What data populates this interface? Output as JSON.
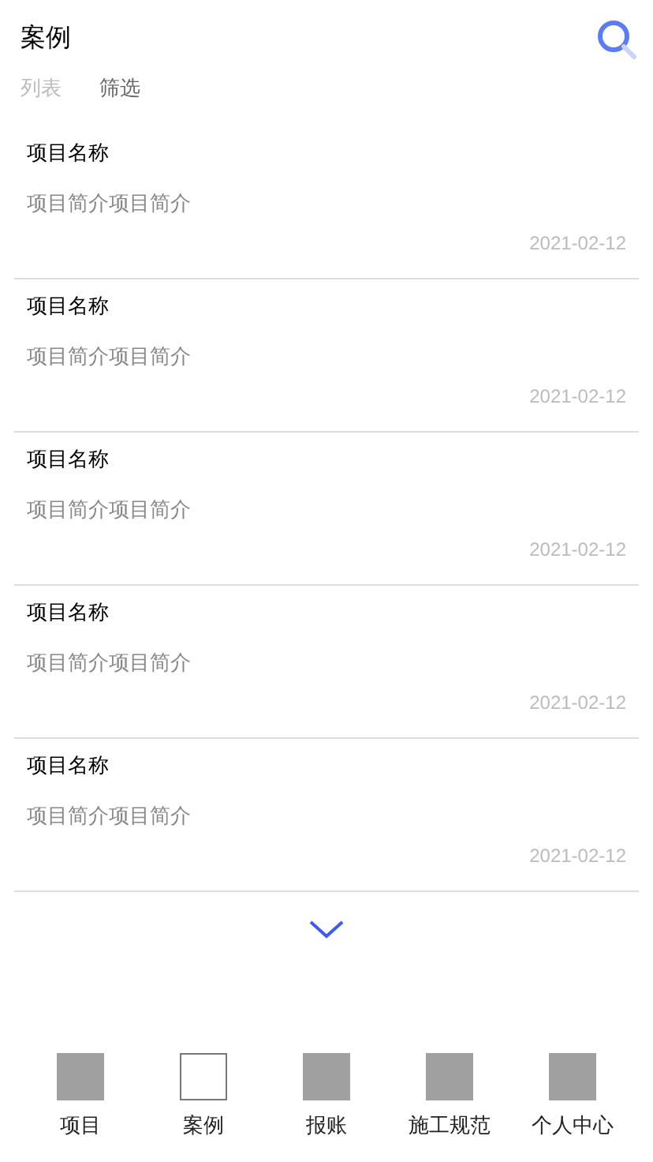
{
  "header": {
    "title": "案例"
  },
  "tabs": [
    {
      "label": "列表",
      "selected": false
    },
    {
      "label": "筛选",
      "selected": true
    }
  ],
  "cases": [
    {
      "name": "项目名称",
      "summary": "项目简介项目简介",
      "date": "2021-02-12"
    },
    {
      "name": "项目名称",
      "summary": "项目简介项目简介",
      "date": "2021-02-12"
    },
    {
      "name": "项目名称",
      "summary": "项目简介项目简介",
      "date": "2021-02-12"
    },
    {
      "name": "项目名称",
      "summary": "项目简介项目简介",
      "date": "2021-02-12"
    },
    {
      "name": "项目名称",
      "summary": "项目简介项目简介",
      "date": "2021-02-12"
    }
  ],
  "bottom_nav": [
    {
      "label": "项目",
      "selected": false
    },
    {
      "label": "案例",
      "selected": true
    },
    {
      "label": "报账",
      "selected": false
    },
    {
      "label": "施工规范",
      "selected": false
    },
    {
      "label": "个人中心",
      "selected": false
    }
  ]
}
